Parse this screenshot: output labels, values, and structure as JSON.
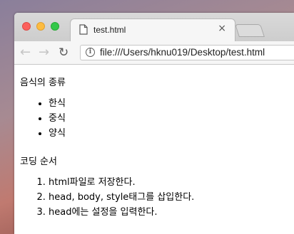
{
  "browser": {
    "tab_title": "test.html",
    "tab_close_glyph": "×",
    "url": "file:///Users/hknu019/Desktop/test.html",
    "back_glyph": "←",
    "forward_glyph": "→",
    "reload_glyph": "↻",
    "info_glyph": "i"
  },
  "page": {
    "heading1": "음식의 종류",
    "foods": [
      "한식",
      "중식",
      "양식"
    ],
    "heading2": "코딩 순서",
    "steps": [
      "html파일로 저장한다.",
      "head, body, style태그를 삽입한다.",
      "head에는 설정을 입력한다."
    ]
  },
  "colors": {
    "close": "#fc605c",
    "minimize": "#fdbc40",
    "maximize": "#34c84a"
  }
}
